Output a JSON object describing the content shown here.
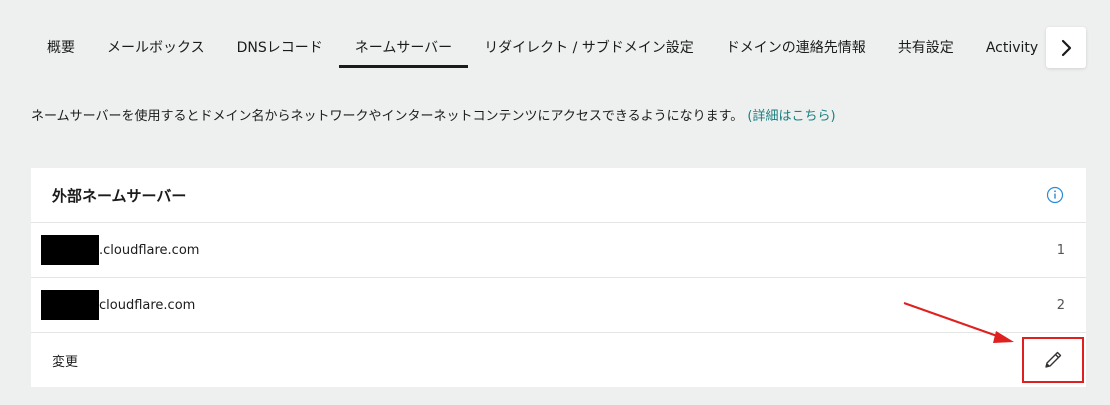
{
  "tabs": [
    {
      "label": "概要"
    },
    {
      "label": "メールボックス"
    },
    {
      "label": "DNSレコード"
    },
    {
      "label": "ネームサーバー",
      "active": true
    },
    {
      "label": "リダイレクト / サブドメイン設定"
    },
    {
      "label": "ドメインの連絡先情報"
    },
    {
      "label": "共有設定"
    },
    {
      "label": "Activity"
    }
  ],
  "description": {
    "text": "ネームサーバーを使用するとドメイン名からネットワークやインターネットコンテンツにアクセスできるようになります。",
    "link": "(詳細はこちら)"
  },
  "card": {
    "title": "外部ネームサーバー",
    "nameservers": [
      {
        "name": ".cloudflare.com",
        "index": "1"
      },
      {
        "name": "cloudflare.com",
        "index": "2"
      }
    ],
    "change_label": "変更"
  },
  "colors": {
    "accent_link": "#1a7f7f",
    "info_icon": "#2a8bd8",
    "highlight": "#e02020",
    "active_tab_underline": "#1b1b1b"
  }
}
